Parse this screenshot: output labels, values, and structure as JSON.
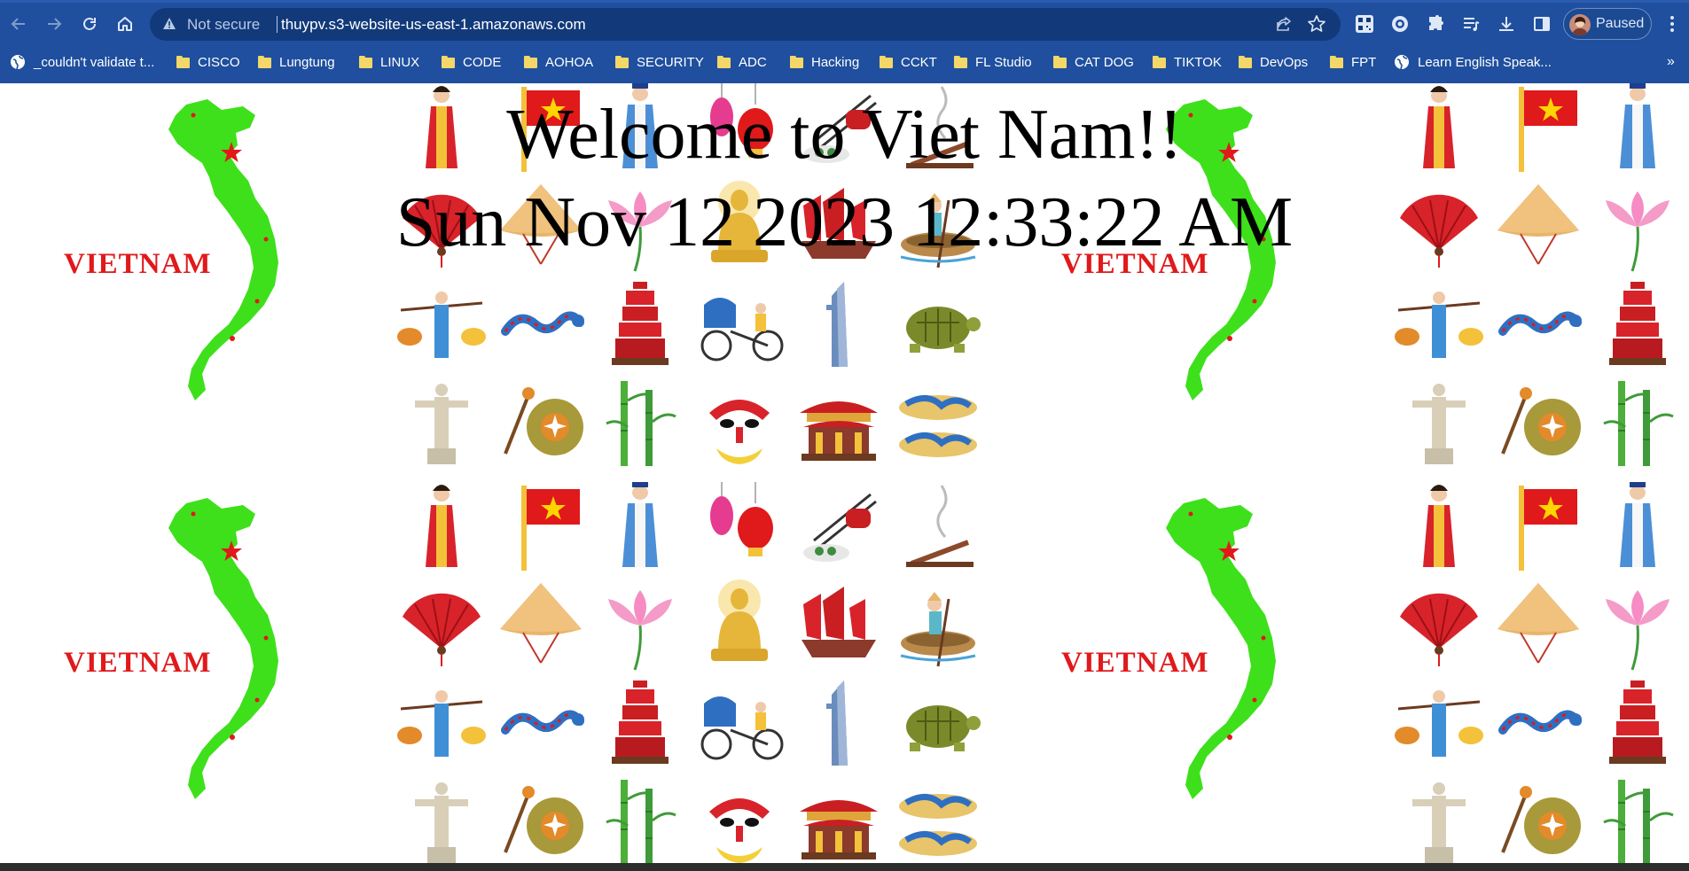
{
  "browser": {
    "address_bar": {
      "security_label": "Not secure",
      "url": "thuypv.s3-website-us-east-1.amazonaws.com"
    },
    "profile": {
      "label": "Paused"
    },
    "bookmarks": [
      {
        "label": "_couldn't validate t...",
        "icon": "globe-icon"
      },
      {
        "label": "CISCO",
        "icon": "folder-icon"
      },
      {
        "label": "Lungtung",
        "icon": "folder-icon"
      },
      {
        "label": "LINUX",
        "icon": "folder-icon"
      },
      {
        "label": "CODE",
        "icon": "folder-icon"
      },
      {
        "label": "AOHOA",
        "icon": "folder-icon"
      },
      {
        "label": "SECURITY",
        "icon": "folder-icon"
      },
      {
        "label": "ADC",
        "icon": "folder-icon"
      },
      {
        "label": "Hacking",
        "icon": "folder-icon"
      },
      {
        "label": "CCKT",
        "icon": "folder-icon"
      },
      {
        "label": "FL Studio",
        "icon": "folder-icon"
      },
      {
        "label": "CAT DOG",
        "icon": "folder-icon"
      },
      {
        "label": "TIKTOK",
        "icon": "folder-icon"
      },
      {
        "label": "DevOps",
        "icon": "folder-icon"
      },
      {
        "label": "FPT",
        "icon": "folder-icon"
      },
      {
        "label": "Learn English Speak...",
        "icon": "globe-icon"
      }
    ],
    "bookmarks_overflow": "»"
  },
  "page": {
    "title": "Welcome to Viet Nam!!",
    "datetime": "Sun Nov 12 2023 12:33:22 AM",
    "background": {
      "map_label": "VIETNAM",
      "illustrations": [
        "ao-dai-woman",
        "vietnam-flag",
        "ao-dai-man",
        "lanterns",
        "chopsticks-roll",
        "incense",
        "hand-fan",
        "conical-hat",
        "lotus-flower",
        "buddha-statue",
        "junk-boat",
        "basket-boat",
        "street-vendor",
        "dragon",
        "pagoda",
        "cyclo",
        "bitexco-tower",
        "turtle",
        "statue",
        "gong",
        "bamboo",
        "tuong-mask",
        "temple",
        "sandals"
      ]
    }
  },
  "colors": {
    "chrome": "#1f4f9e",
    "omnibox": "#123a7a",
    "map_green": "#3ee01b",
    "vietnam_red": "#e0191b"
  }
}
